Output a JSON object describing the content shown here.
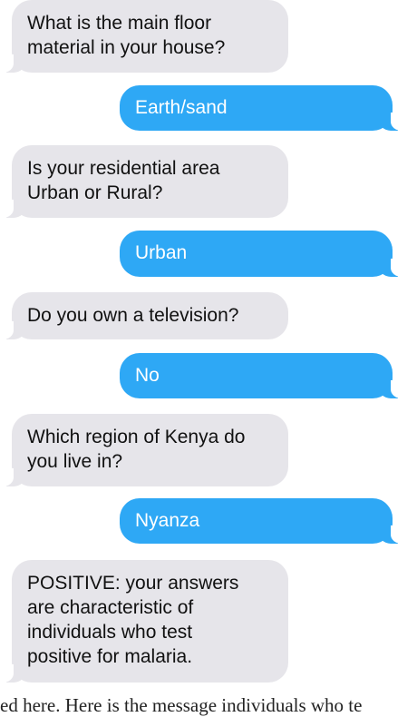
{
  "conversation": {
    "messages": [
      {
        "sender": "bot",
        "text": "What is the main floor\nmaterial in your house?"
      },
      {
        "sender": "user",
        "text": "Earth/sand"
      },
      {
        "sender": "bot",
        "text": "Is your residential area\nUrban or Rural?"
      },
      {
        "sender": "user",
        "text": "Urban"
      },
      {
        "sender": "bot",
        "text": "Do you own a television?"
      },
      {
        "sender": "user",
        "text": "No"
      },
      {
        "sender": "bot",
        "text": "Which region of Kenya do\nyou live in?"
      },
      {
        "sender": "user",
        "text": "Nyanza"
      },
      {
        "sender": "bot",
        "text": "POSITIVE: your answers\nare characteristic of\nindividuals who test\npositive for malaria."
      }
    ]
  },
  "caption": {
    "text": "ed here. Here is the message individuals who te"
  },
  "colors": {
    "incoming_bubble": "#e6e5ea",
    "outgoing_bubble": "#2ea8f5",
    "outgoing_text": "#ffffff",
    "incoming_text": "#111111"
  }
}
